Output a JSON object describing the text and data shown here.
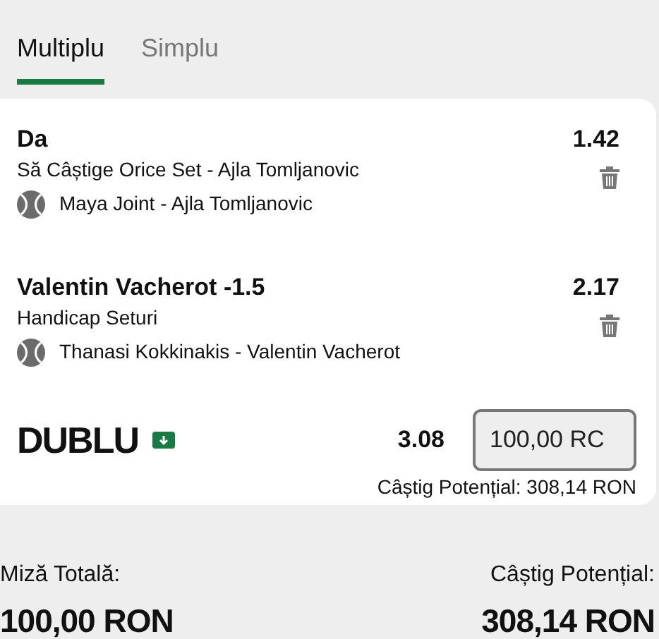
{
  "tabs": [
    {
      "label": "Multiplu",
      "selected": true
    },
    {
      "label": "Simplu",
      "selected": false
    }
  ],
  "selections": [
    {
      "pick": "Da",
      "odds": "1.42",
      "market": "Să Câștige Orice Set - Ajla Tomljanovic",
      "event": "Maya Joint - Ajla Tomljanovic"
    },
    {
      "pick": "Valentin Vacherot -1.5",
      "odds": "2.17",
      "market": "Handicap Seturi",
      "event": "Thanasi Kokkinakis - Valentin Vacherot"
    }
  ],
  "bet": {
    "type": "DUBLU",
    "total_odds": "3.08",
    "stake": "100,00 RC",
    "potential": "Câștig Potențial: 308,14 RON"
  },
  "summary": {
    "stake_label": "Miză Totală:",
    "stake_value": "100,00 RON",
    "win_label": "Câștig Potențial:",
    "win_value": "308,14 RON"
  }
}
